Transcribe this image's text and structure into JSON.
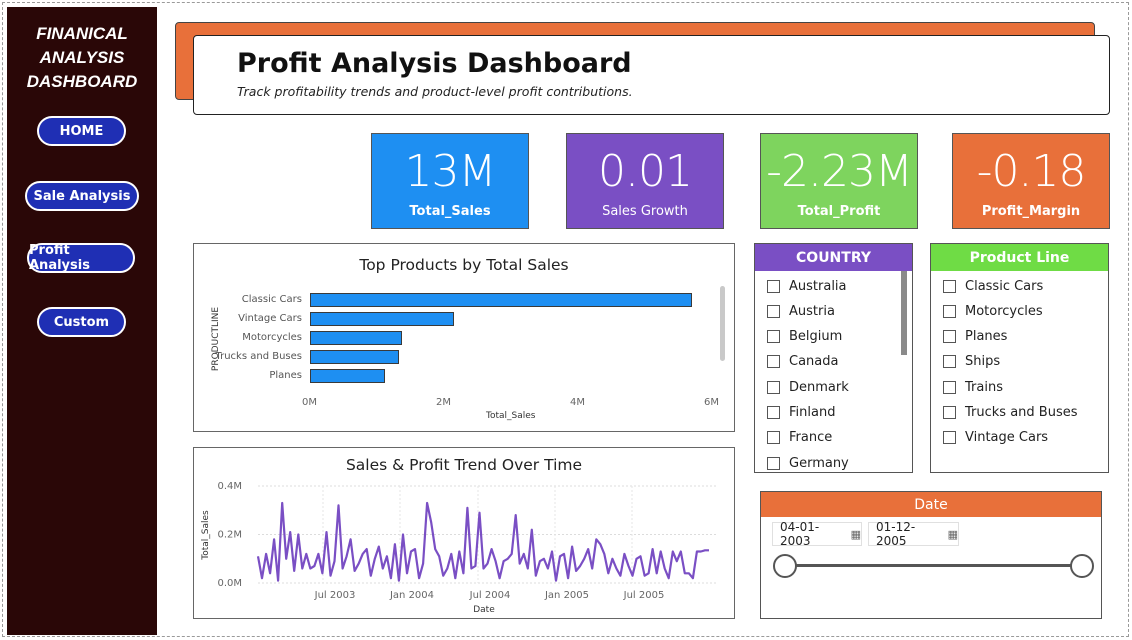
{
  "sidebar": {
    "title_lines": [
      "FINANICAL",
      "ANALYSIS",
      "DASHBOARD"
    ],
    "nav": [
      "HOME",
      "Sale Analysis",
      "Profit Analysis",
      "Custom"
    ]
  },
  "header": {
    "title": "Profit Analysis Dashboard",
    "subtitle": "Track profitability trends and product-level profit contributions."
  },
  "kpis": [
    {
      "value": "13M",
      "label": "Total_Sales",
      "color": "#1e8ff2"
    },
    {
      "value": "0.01",
      "label": "Sales Growth",
      "color": "#7a4fc4"
    },
    {
      "value": "-2.23M",
      "label": "Total_Profit",
      "color": "#7ed45e"
    },
    {
      "value": "-0.18",
      "label": "Profit_Margin",
      "color": "#e8703a"
    }
  ],
  "bar_panel": {
    "title": "Top Products by Total Sales"
  },
  "line_panel": {
    "title": "Sales & Profit Trend Over Time"
  },
  "chart_data": [
    {
      "type": "bar",
      "title": "Top Products by Total Sales",
      "xlabel": "Total_Sales",
      "ylabel": "PRODUCTLINE",
      "categories": [
        "Classic Cars",
        "Vintage Cars",
        "Motorcycles",
        "Trucks and Buses",
        "Planes"
      ],
      "values": [
        5700000,
        2150000,
        1370000,
        1330000,
        1120000
      ],
      "xlim": [
        0,
        6000000
      ],
      "x_ticks": [
        "0M",
        "2M",
        "4M",
        "6M"
      ],
      "color": "#1e8ff2"
    },
    {
      "type": "line",
      "title": "Sales & Profit Trend Over Time",
      "xlabel": "Date",
      "ylabel": "Total_Sales",
      "ylim": [
        0,
        400000
      ],
      "y_ticks": [
        "0.0M",
        "0.2M",
        "0.4M"
      ],
      "x_ticks": [
        "Jul 2003",
        "Jan 2004",
        "Jul 2004",
        "Jan 2005",
        "Jul 2005"
      ],
      "color": "#7a4fc4",
      "series": [
        {
          "values": [
            110000,
            20000,
            120000,
            40000,
            180000,
            10000,
            330000,
            100000,
            210000,
            50000,
            200000,
            60000,
            120000,
            60000,
            70000,
            120000,
            40000,
            210000,
            30000,
            90000,
            320000,
            60000,
            110000,
            180000,
            50000,
            80000,
            120000,
            140000,
            30000,
            100000,
            150000,
            60000,
            110000,
            20000,
            160000,
            10000,
            200000,
            40000,
            130000,
            140000,
            20000,
            80000,
            330000,
            250000,
            140000,
            110000,
            30000,
            60000,
            120000,
            20000,
            130000,
            40000,
            310000,
            60000,
            70000,
            290000,
            60000,
            80000,
            140000,
            90000,
            20000,
            90000,
            100000,
            120000,
            280000,
            80000,
            120000,
            60000,
            220000,
            30000,
            90000,
            100000,
            60000,
            130000,
            10000,
            110000,
            120000,
            20000,
            150000,
            50000,
            70000,
            100000,
            140000,
            60000,
            180000,
            160000,
            120000,
            40000,
            100000,
            60000,
            30000,
            120000,
            70000,
            30000,
            100000,
            110000,
            30000,
            40000,
            140000,
            40000,
            130000,
            60000,
            20000,
            130000,
            90000,
            130000,
            40000,
            40000,
            20000,
            130000,
            130000,
            135000,
            135000
          ]
        }
      ]
    }
  ],
  "country_slicer": {
    "title": "COUNTRY",
    "items": [
      "Australia",
      "Austria",
      "Belgium",
      "Canada",
      "Denmark",
      "Finland",
      "France",
      "Germany"
    ],
    "color": "#7a4fc4"
  },
  "product_slicer": {
    "title": "Product Line",
    "items": [
      "Classic Cars",
      "Motorcycles",
      "Planes",
      "Ships",
      "Trains",
      "Trucks and Buses",
      "Vintage Cars"
    ],
    "color": "#6fdc45"
  },
  "date_slicer": {
    "title": "Date",
    "start": "04-01-2003",
    "end": "01-12-2005",
    "color": "#e8703a"
  }
}
